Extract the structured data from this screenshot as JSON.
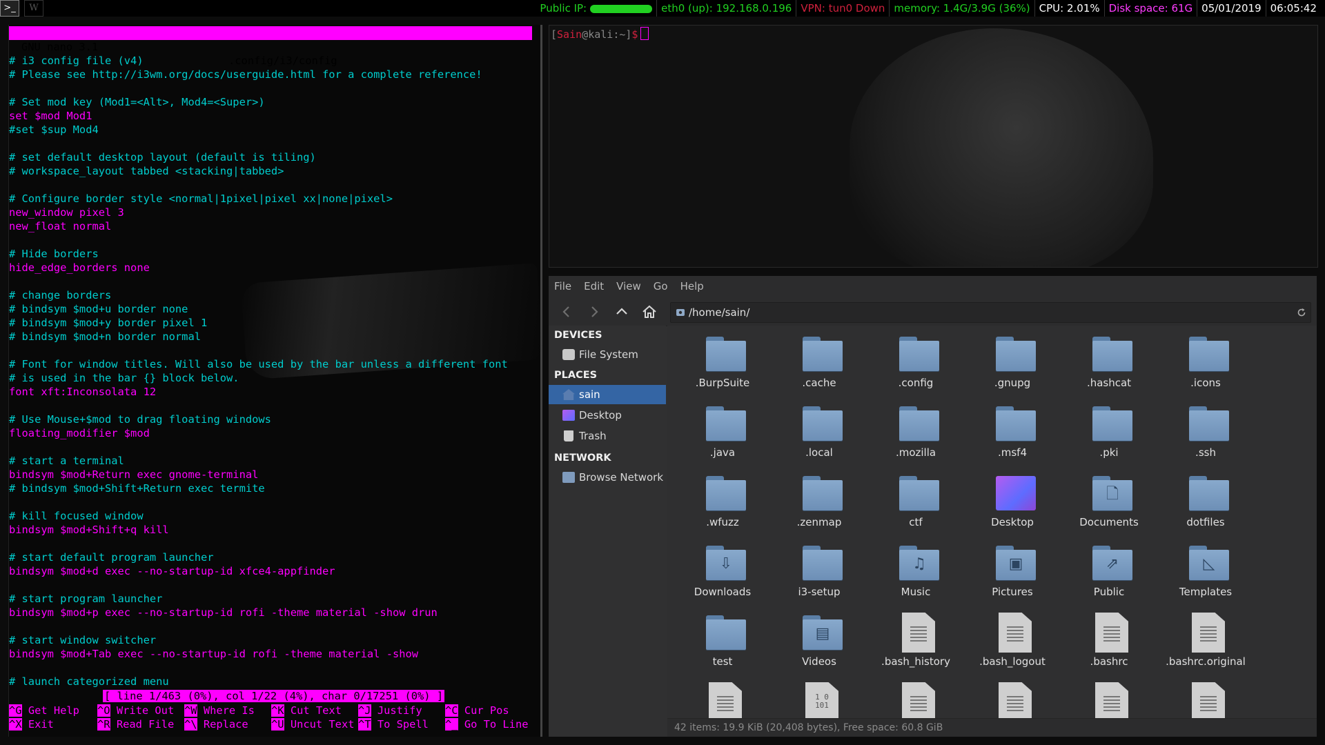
{
  "topbar": {
    "workspaces": [
      ">_",
      "W"
    ],
    "public_ip_label": "Public IP:",
    "eth0": "eth0 (up): 192.168.0.196",
    "vpn": "VPN: tun0 Down",
    "memory": "memory: 1.4G/3.9G (36%)",
    "cpu": "CPU: 2.01%",
    "disk": "Disk space: 61G",
    "date": "05/01/2019",
    "time": "06:05:42",
    "colors": {
      "green": "#21d021",
      "red": "#d0213d",
      "magenta": "#ff3cff",
      "white": "#ffffff"
    }
  },
  "nano": {
    "version": "GNU nano 3.1",
    "filename": ".config/i3/config",
    "lines": [
      {
        "t": "# i3 config file (v4)",
        "k": "c"
      },
      {
        "t": "# Please see http://i3wm.org/docs/userguide.html for a complete reference!",
        "k": "c"
      },
      {
        "t": "",
        "k": "c"
      },
      {
        "t": "# Set mod key (Mod1=<Alt>, Mod4=<Super>)",
        "k": "c"
      },
      {
        "t": "set $mod Mod1",
        "k": "k"
      },
      {
        "t": "#set $sup Mod4",
        "k": "c"
      },
      {
        "t": "",
        "k": "c"
      },
      {
        "t": "# set default desktop layout (default is tiling)",
        "k": "c"
      },
      {
        "t": "# workspace_layout tabbed <stacking|tabbed>",
        "k": "c"
      },
      {
        "t": "",
        "k": "c"
      },
      {
        "t": "# Configure border style <normal|1pixel|pixel xx|none|pixel>",
        "k": "c"
      },
      {
        "t": "new_window pixel 3",
        "k": "k"
      },
      {
        "t": "new_float normal",
        "k": "k"
      },
      {
        "t": "",
        "k": "c"
      },
      {
        "t": "# Hide borders",
        "k": "c"
      },
      {
        "t": "hide_edge_borders none",
        "k": "k"
      },
      {
        "t": "",
        "k": "c"
      },
      {
        "t": "# change borders",
        "k": "c"
      },
      {
        "t": "# bindsym $mod+u border none",
        "k": "c"
      },
      {
        "t": "# bindsym $mod+y border pixel 1",
        "k": "c"
      },
      {
        "t": "# bindsym $mod+n border normal",
        "k": "c"
      },
      {
        "t": "",
        "k": "c"
      },
      {
        "t": "# Font for window titles. Will also be used by the bar unless a different font",
        "k": "c"
      },
      {
        "t": "# is used in the bar {} block below.",
        "k": "c"
      },
      {
        "t": "font xft:Inconsolata 12",
        "k": "k"
      },
      {
        "t": "",
        "k": "c"
      },
      {
        "t": "# Use Mouse+$mod to drag floating windows",
        "k": "c"
      },
      {
        "t": "floating_modifier $mod",
        "k": "k"
      },
      {
        "t": "",
        "k": "c"
      },
      {
        "t": "# start a terminal",
        "k": "c"
      },
      {
        "t": "bindsym $mod+Return exec gnome-terminal",
        "k": "k"
      },
      {
        "t": "# bindsym $mod+Shift+Return exec termite",
        "k": "c"
      },
      {
        "t": "",
        "k": "c"
      },
      {
        "t": "# kill focused window",
        "k": "c"
      },
      {
        "t": "bindsym $mod+Shift+q kill",
        "k": "k"
      },
      {
        "t": "",
        "k": "c"
      },
      {
        "t": "# start default program launcher",
        "k": "c"
      },
      {
        "t": "bindsym $mod+d exec --no-startup-id xfce4-appfinder",
        "k": "k"
      },
      {
        "t": "",
        "k": "c"
      },
      {
        "t": "# start program launcher",
        "k": "c"
      },
      {
        "t": "bindsym $mod+p exec --no-startup-id rofi -theme material -show drun",
        "k": "k"
      },
      {
        "t": "",
        "k": "c"
      },
      {
        "t": "# start window switcher",
        "k": "c"
      },
      {
        "t": "bindsym $mod+Tab exec --no-startup-id rofi -theme material -show",
        "k": "k"
      },
      {
        "t": "",
        "k": "c"
      },
      {
        "t": "# launch categorized menu",
        "k": "c"
      }
    ],
    "status": "[ line 1/463 (0%), col 1/22 (4%), char 0/17251 (0%) ]",
    "shortcuts": [
      {
        "key": "^G",
        "label": "Get Help"
      },
      {
        "key": "^X",
        "label": "Exit"
      },
      {
        "key": "^O",
        "label": "Write Out"
      },
      {
        "key": "^R",
        "label": "Read File"
      },
      {
        "key": "^W",
        "label": "Where Is"
      },
      {
        "key": "^\\",
        "label": "Replace"
      },
      {
        "key": "^K",
        "label": "Cut Text"
      },
      {
        "key": "^U",
        "label": "Uncut Text"
      },
      {
        "key": "^J",
        "label": "Justify"
      },
      {
        "key": "^T",
        "label": "To Spell"
      },
      {
        "key": "^C",
        "label": "Cur Pos"
      },
      {
        "key": "^_",
        "label": "Go To Line"
      }
    ]
  },
  "terminal": {
    "user": "Sain",
    "host": "kali",
    "path": "~",
    "symbol": "$"
  },
  "filemanager": {
    "menu": [
      "File",
      "Edit",
      "View",
      "Go",
      "Help"
    ],
    "path": "/home/sain/",
    "sidebar": {
      "devices_heading": "DEVICES",
      "devices": [
        {
          "label": "File System",
          "icon": "drive-icon"
        }
      ],
      "places_heading": "PLACES",
      "places": [
        {
          "label": "sain",
          "icon": "home-icon",
          "selected": true
        },
        {
          "label": "Desktop",
          "icon": "desktop-icon",
          "selected": false
        },
        {
          "label": "Trash",
          "icon": "trash-icon",
          "selected": false
        }
      ],
      "network_heading": "NETWORK",
      "network": [
        {
          "label": "Browse Network",
          "icon": "network-icon"
        }
      ]
    },
    "items": [
      {
        "name": ".BurpSuite",
        "type": "folder"
      },
      {
        "name": ".cache",
        "type": "folder"
      },
      {
        "name": ".config",
        "type": "folder"
      },
      {
        "name": ".gnupg",
        "type": "folder"
      },
      {
        "name": ".hashcat",
        "type": "folder"
      },
      {
        "name": ".icons",
        "type": "folder"
      },
      {
        "name": ".java",
        "type": "folder"
      },
      {
        "name": ".local",
        "type": "folder"
      },
      {
        "name": ".mozilla",
        "type": "folder"
      },
      {
        "name": ".msf4",
        "type": "folder"
      },
      {
        "name": ".pki",
        "type": "folder"
      },
      {
        "name": ".ssh",
        "type": "folder"
      },
      {
        "name": ".wfuzz",
        "type": "folder"
      },
      {
        "name": ".zenmap",
        "type": "folder"
      },
      {
        "name": "ctf",
        "type": "folder"
      },
      {
        "name": "Desktop",
        "type": "desktop"
      },
      {
        "name": "Documents",
        "type": "folder",
        "symbol": "🗋"
      },
      {
        "name": "dotfiles",
        "type": "folder"
      },
      {
        "name": "Downloads",
        "type": "folder",
        "symbol": "⇩"
      },
      {
        "name": "i3-setup",
        "type": "folder"
      },
      {
        "name": "Music",
        "type": "folder",
        "symbol": "♫"
      },
      {
        "name": "Pictures",
        "type": "folder",
        "symbol": "▣"
      },
      {
        "name": "Public",
        "type": "folder",
        "symbol": "⇗"
      },
      {
        "name": "Templates",
        "type": "folder",
        "symbol": "◺"
      },
      {
        "name": "test",
        "type": "folder"
      },
      {
        "name": "Videos",
        "type": "folder",
        "symbol": "▤"
      },
      {
        "name": ".bash_history",
        "type": "text"
      },
      {
        "name": ".bash_logout",
        "type": "text"
      },
      {
        "name": ".bashrc",
        "type": "text"
      },
      {
        "name": ".bashrc.original",
        "type": "text"
      },
      {
        "name": "",
        "type": "text"
      },
      {
        "name": "",
        "type": "binary",
        "symbol": "1 0\n101"
      },
      {
        "name": "",
        "type": "text"
      },
      {
        "name": "",
        "type": "text"
      },
      {
        "name": "",
        "type": "text"
      },
      {
        "name": "",
        "type": "text"
      }
    ],
    "status": "42 items: 19.9 KiB (20,408 bytes), Free space: 60.8 GiB",
    "colors": {
      "selection": "#3465a4",
      "folder": "#7a9cc2"
    }
  }
}
